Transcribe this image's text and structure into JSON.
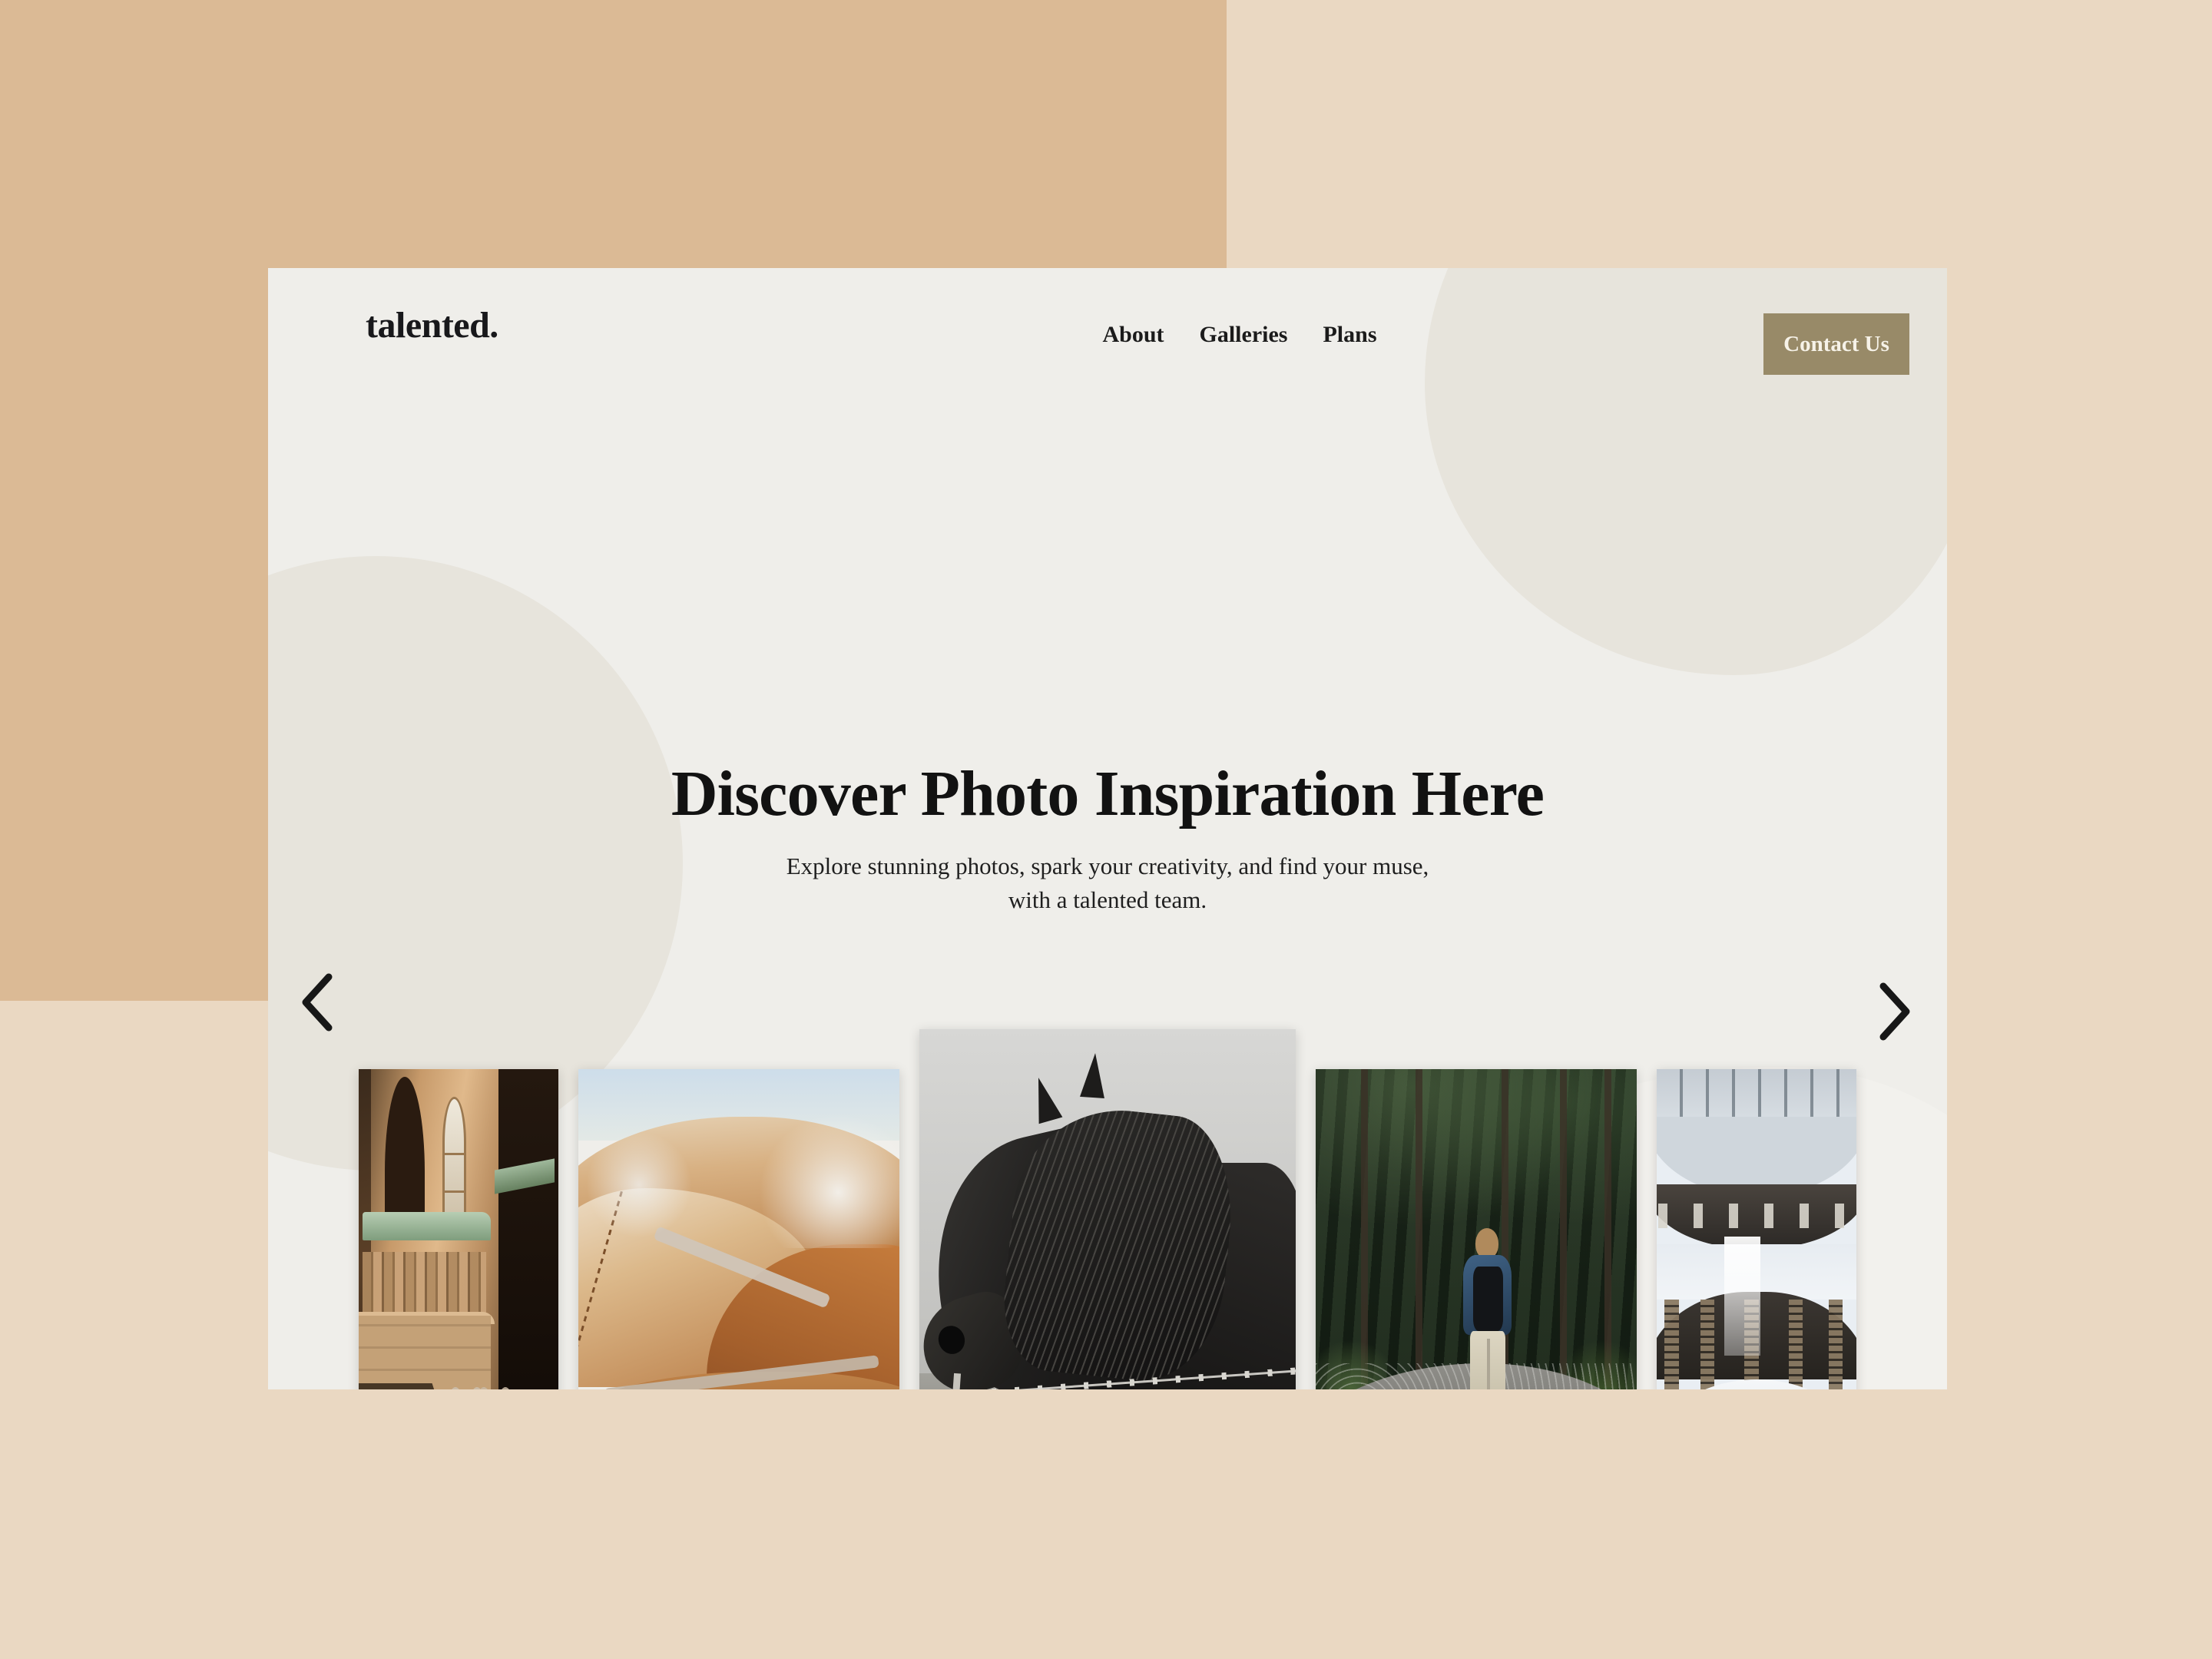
{
  "palette": {
    "bg_light": "#ead8c2",
    "bg_dark": "#dbba95",
    "card_bg": "#efeeea",
    "blob": "#e7e4dc",
    "accent": "#988a68",
    "text_dark": "#121212",
    "button_text": "#f6f2e8"
  },
  "header": {
    "logo": "talented.",
    "nav": [
      {
        "label": "About"
      },
      {
        "label": "Galleries"
      },
      {
        "label": "Plans"
      }
    ],
    "cta_label": "Contact Us"
  },
  "hero": {
    "headline": "Discover Photo Inspiration Here",
    "subtitle_line1": "Explore stunning photos, spark your creativity, and find your muse,",
    "subtitle_line2": "with a talented team."
  },
  "carousel": {
    "prev_icon": "chevron-left-icon",
    "next_icon": "chevron-right-icon",
    "slides": [
      {
        "alt": "Stone church tower with arched window and bicycles at golden hour",
        "size": "small"
      },
      {
        "alt": "Rust-coloured geothermal hills with winding trail and steam",
        "size": "mid"
      },
      {
        "alt": "Black and white portrait of a dark horse behind barbed wire",
        "size": "big"
      },
      {
        "alt": "Hiker with backpack walking a gravel path through dense forest",
        "size": "mid"
      },
      {
        "alt": "Bright modern library atrium looking up past dark bookshelves",
        "size": "small"
      }
    ]
  }
}
